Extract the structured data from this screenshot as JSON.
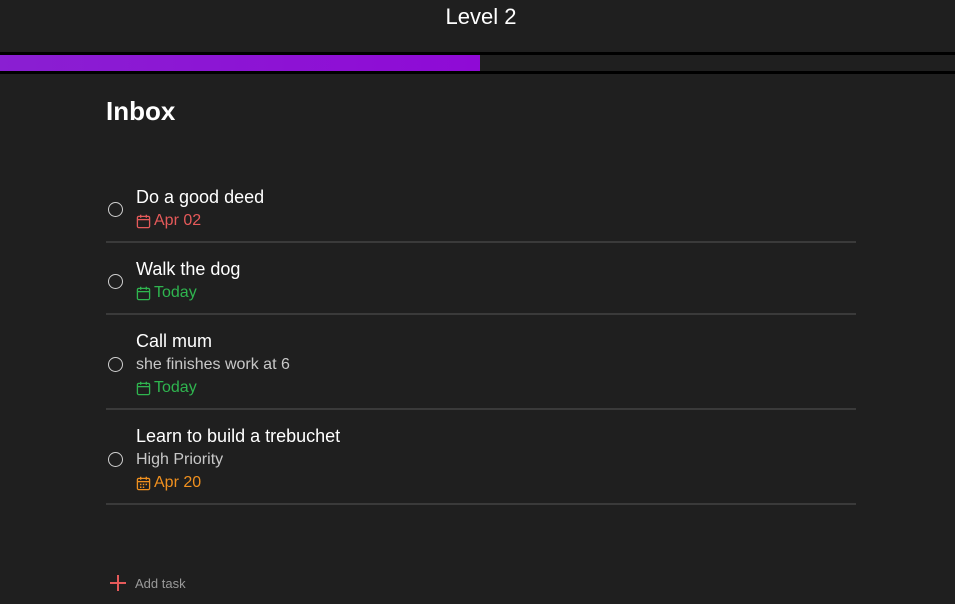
{
  "header": {
    "level_title": "Level 2",
    "progress_fraction": 0.503,
    "progress_color": "#8f0ad6"
  },
  "inbox": {
    "title": "Inbox",
    "tasks": [
      {
        "title": "Do a good deed",
        "description": "",
        "due": "Apr 02",
        "due_color": "#e55a5a",
        "due_icon": "calendar-icon"
      },
      {
        "title": "Walk the dog",
        "description": "",
        "due": "Today",
        "due_color": "#2fb54f",
        "due_icon": "calendar-icon"
      },
      {
        "title": "Call mum",
        "description": "she finishes work at 6",
        "due": "Today",
        "due_color": "#2fb54f",
        "due_icon": "calendar-icon"
      },
      {
        "title": "Learn to build a trebuchet",
        "description": "High Priority",
        "due": "Apr 20",
        "due_color": "#f0901f",
        "due_icon": "calendar-icon"
      }
    ]
  },
  "add_task": {
    "label": "Add task",
    "icon": "plus-icon",
    "icon_color": "#e55a5a"
  }
}
